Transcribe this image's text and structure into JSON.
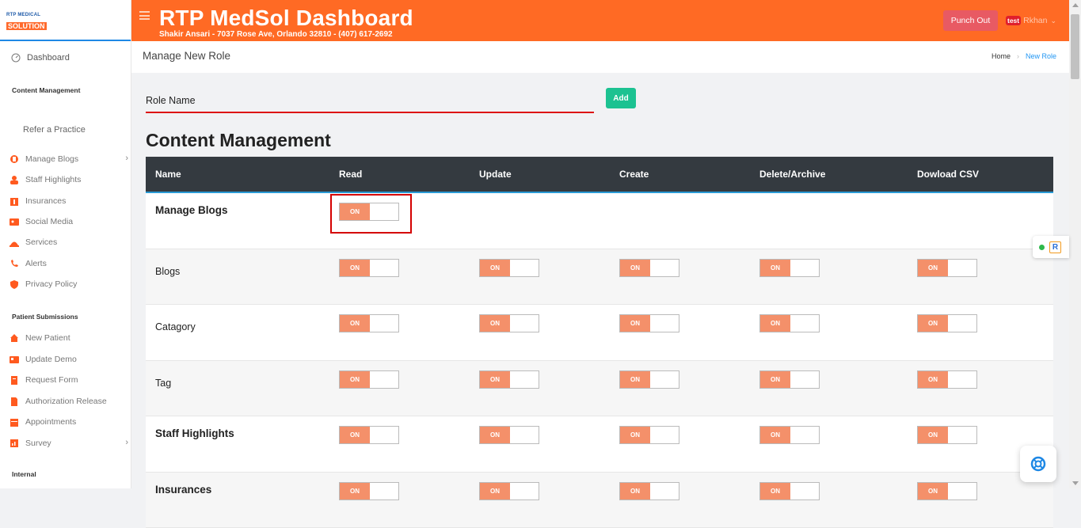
{
  "sidebar": {
    "logo_line1": "RTP MEDICAL",
    "logo_line2": "SOLUTION",
    "dashboard": "Dashboard",
    "section_content": "Content Management",
    "refer": "Refer a Practice",
    "content_items": [
      {
        "label": "Manage Blogs",
        "icon": "blog-icon",
        "chevron": true
      },
      {
        "label": "Staff Highlights",
        "icon": "staff-icon",
        "chevron": false
      },
      {
        "label": "Insurances",
        "icon": "insurance-icon",
        "chevron": false
      },
      {
        "label": "Social Media",
        "icon": "social-media-icon",
        "chevron": false
      },
      {
        "label": "Services",
        "icon": "services-icon",
        "chevron": false
      },
      {
        "label": "Alerts",
        "icon": "alerts-icon",
        "chevron": false
      },
      {
        "label": "Privacy Policy",
        "icon": "privacy-icon",
        "chevron": false
      }
    ],
    "section_patient": "Patient Submissions",
    "patient_items": [
      {
        "label": "New Patient",
        "icon": "home-icon",
        "chevron": false
      },
      {
        "label": "Update Demo",
        "icon": "id-card-icon",
        "chevron": false
      },
      {
        "label": "Request Form",
        "icon": "form-icon",
        "chevron": false
      },
      {
        "label": "Authorization Release",
        "icon": "document-icon",
        "chevron": false
      },
      {
        "label": "Appointments",
        "icon": "calendar-icon",
        "chevron": false
      },
      {
        "label": "Survey",
        "icon": "chart-icon",
        "chevron": true
      }
    ],
    "section_internal": "Internal"
  },
  "header": {
    "title": "RTP MedSol Dashboard",
    "subtitle": "Shakir Ansari - 7037 Rose Ave, Orlando 32810 - (407) 617-2692",
    "punch_out": "Punch Out",
    "user_badge": "test",
    "user_name": "Rkhan",
    "accent": "#ff6a24"
  },
  "crumb": {
    "page_title": "Manage New Role",
    "home": "Home",
    "current": "New Role"
  },
  "form": {
    "role_name_placeholder": "Role Name",
    "add_label": "Add"
  },
  "section_heading": "Content Management",
  "table": {
    "columns": [
      "Name",
      "Read",
      "Update",
      "Create",
      "Delete/Archive",
      "Dowload CSV"
    ],
    "toggle_label": "ON",
    "rows": [
      {
        "name": "Manage Blogs",
        "bold": true,
        "toggles": [
          true,
          false,
          false,
          false,
          false
        ]
      },
      {
        "name": "Blogs",
        "bold": false,
        "toggles": [
          true,
          true,
          true,
          true,
          true
        ]
      },
      {
        "name": "Catagory",
        "bold": false,
        "toggles": [
          true,
          true,
          true,
          true,
          true
        ]
      },
      {
        "name": "Tag",
        "bold": false,
        "toggles": [
          true,
          true,
          true,
          true,
          true
        ]
      },
      {
        "name": "Staff Highlights",
        "bold": true,
        "toggles": [
          true,
          true,
          true,
          true,
          true
        ]
      },
      {
        "name": "Insurances",
        "bold": true,
        "toggles": [
          true,
          true,
          true,
          true,
          true
        ]
      }
    ]
  },
  "widget": {
    "r_logo": "R"
  }
}
